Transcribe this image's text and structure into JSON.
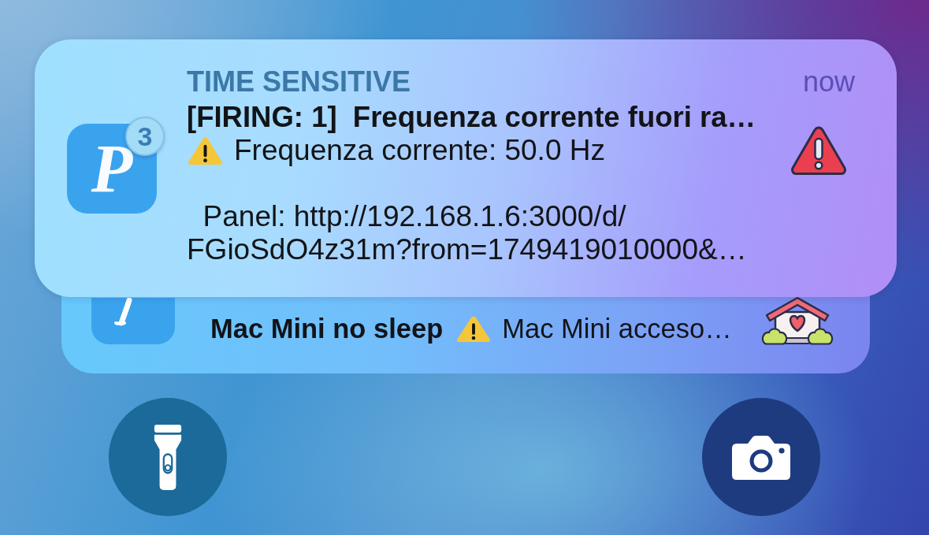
{
  "notifications": [
    {
      "kind": "front",
      "app_icon": {
        "letter": "P",
        "badge": "3"
      },
      "category": "TIME SENSITIVE",
      "time": "now",
      "title": "[FIRING: 1]  Frequenza corrente fuori ra…",
      "paragraphs": [
        {
          "warning_mark": true,
          "text": "Frequenza corrente: 50.0 Hz"
        },
        {
          "warning_mark": false,
          "text": "  Panel: http://192.168.1.6:3000/d/\nFGioSdO4z31m?from=1749419010000&…"
        }
      ],
      "attachment": {
        "kind": "warning"
      }
    },
    {
      "kind": "stacked",
      "title": "Mac Mini no sleep",
      "paragraphs": [
        {
          "warning_mark": true,
          "text": "Mac Mini acceso…"
        }
      ],
      "attachment": {
        "kind": "house"
      }
    }
  ],
  "quick_actions": [
    {
      "kind": "flashlight"
    },
    {
      "kind": "camera"
    }
  ]
}
